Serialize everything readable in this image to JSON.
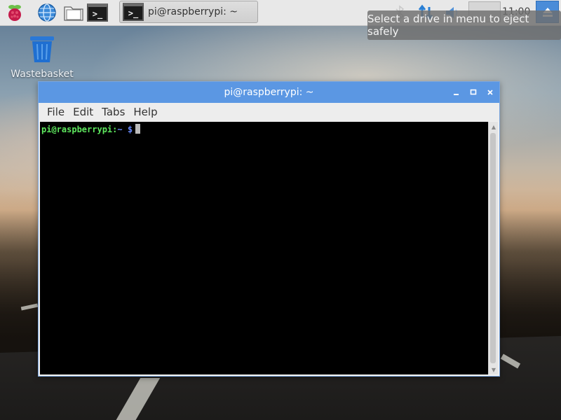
{
  "taskbar": {
    "launchers": [
      {
        "icon": "raspberry-menu-icon"
      },
      {
        "icon": "globe-browser-icon"
      },
      {
        "icon": "file-manager-icon"
      },
      {
        "icon": "terminal-icon"
      }
    ],
    "task": {
      "label": "pi@raspberrypi: ~",
      "icon": "terminal-icon",
      "glyph": ">_"
    },
    "tray": {
      "clock": "11:00",
      "eject_icon": "eject-icon"
    },
    "tooltip": "Select a drive in menu to eject safely"
  },
  "desktop": {
    "icons": [
      {
        "label": "Wastebasket",
        "icon": "trash-icon",
        "color": "#1f6fd1"
      }
    ]
  },
  "window": {
    "title": "pi@raspberrypi: ~",
    "controls": [
      "minimize",
      "maximize",
      "close"
    ],
    "menu": [
      "File",
      "Edit",
      "Tabs",
      "Help"
    ],
    "prompt": {
      "user_host": "pi@raspberrypi",
      "separator": ":",
      "path": "~",
      "symbol": "$"
    }
  },
  "colors": {
    "titlebar": "#5b97e3",
    "prompt_user": "#5ee85e",
    "prompt_path": "#6a8bff"
  }
}
